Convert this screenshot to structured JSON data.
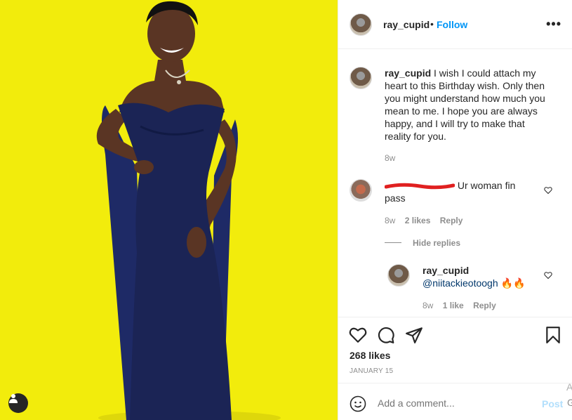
{
  "post": {
    "username": "ray_cupid",
    "follow_label": "Follow",
    "dot": "•",
    "more_label": "•••",
    "caption": "I wish I could attach my heart to this Birthday wish. Only then you might understand how much you mean to me. I hope you are always happy, and I will try to make that reality for you.",
    "caption_time": "8w",
    "likes": "268 likes",
    "date": "JANUARY 15"
  },
  "comments": [
    {
      "username_redacted": true,
      "text": "Ur woman fin pass",
      "time": "8w",
      "likes": "2 likes",
      "reply_label": "Reply"
    }
  ],
  "hide_replies_label": "Hide replies",
  "reply": {
    "username": "ray_cupid",
    "mention": "@niitackieotoogh",
    "emoji": "🔥🔥",
    "time": "8w",
    "likes": "1 like",
    "reply_label": "Reply"
  },
  "add_comment": {
    "placeholder": "Add a comment...",
    "post_label": "Post"
  },
  "stray_chars": {
    "a": "A",
    "b": "G"
  },
  "icons": {
    "like": "heart-icon",
    "comment": "comment-bubble-icon",
    "share": "paper-plane-icon",
    "save": "bookmark-icon",
    "emoji": "smiley-icon",
    "user_tag": "user-silhouette-icon"
  },
  "colors": {
    "accent": "#0095f6",
    "photo_bg": "#f2ec0c",
    "dress": "#1b2455"
  }
}
